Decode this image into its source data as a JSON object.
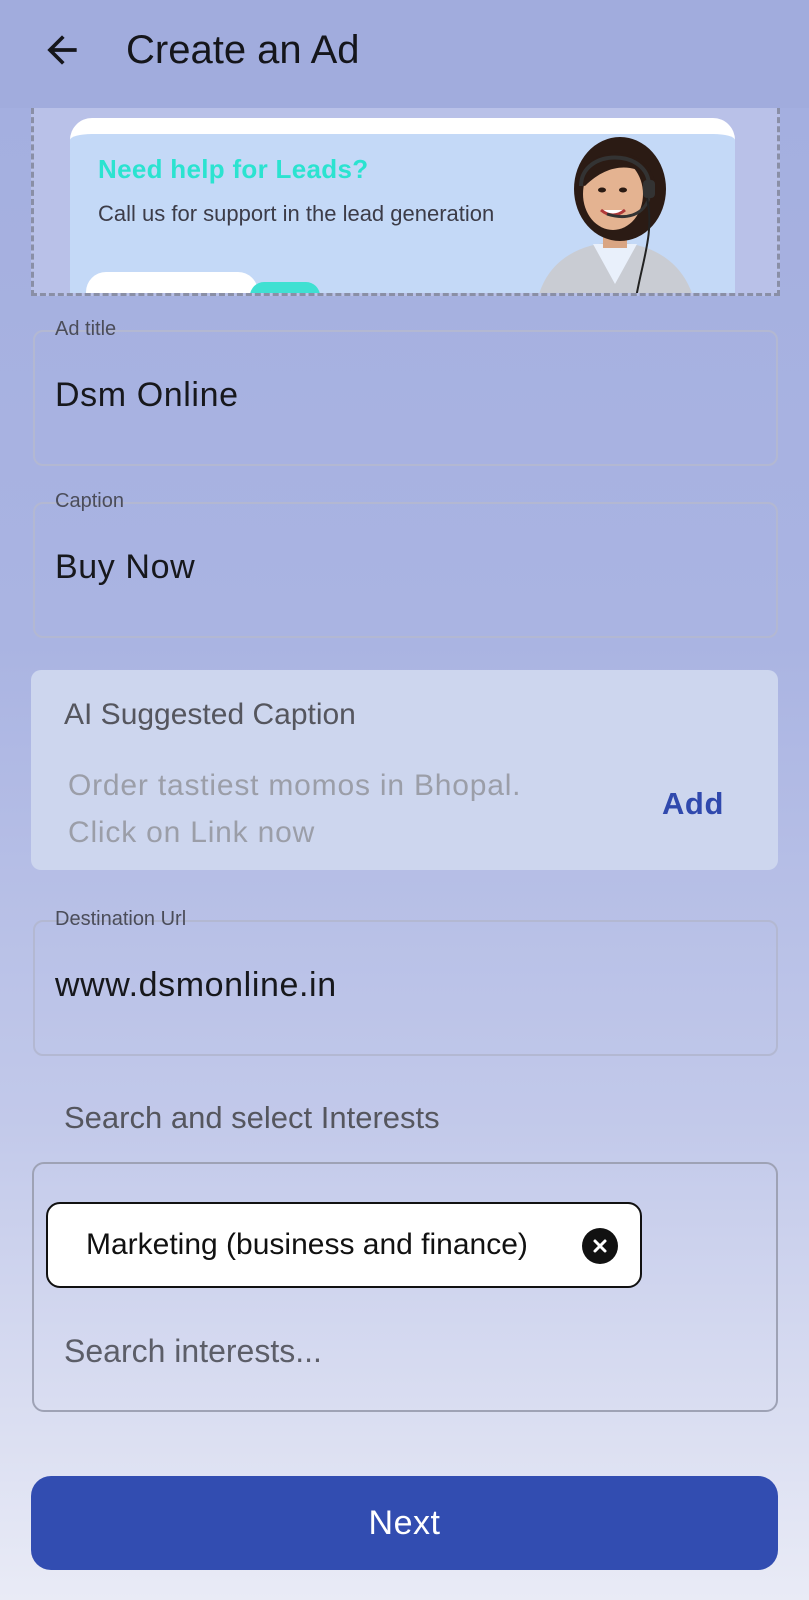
{
  "appbar": {
    "title": "Create an Ad",
    "back_icon": "arrow-left-icon"
  },
  "banner": {
    "headline": "Need help for  Leads?",
    "subtext": "Call us for support in the lead generation",
    "image": "support-agent-headset",
    "headline_color": "#2be3d0"
  },
  "fields": {
    "ad_title": {
      "label": "Ad title",
      "value": "Dsm Online"
    },
    "caption": {
      "label": "Caption",
      "value": "Buy Now"
    },
    "destination_url": {
      "label": "Destination Url",
      "value": "www.dsmonline.in"
    }
  },
  "ai_suggestion": {
    "title": "AI Suggested Caption",
    "text": "Order tastiest momos in Bhopal. Click on Link now",
    "action_label": "Add"
  },
  "interests": {
    "heading": "Search and select Interests",
    "selected": [
      {
        "label": "Marketing (business and finance)",
        "remove_icon": "close-circle-icon"
      }
    ],
    "search_placeholder": "Search interests..."
  },
  "footer": {
    "next_label": "Next",
    "accent": "#324db1"
  }
}
